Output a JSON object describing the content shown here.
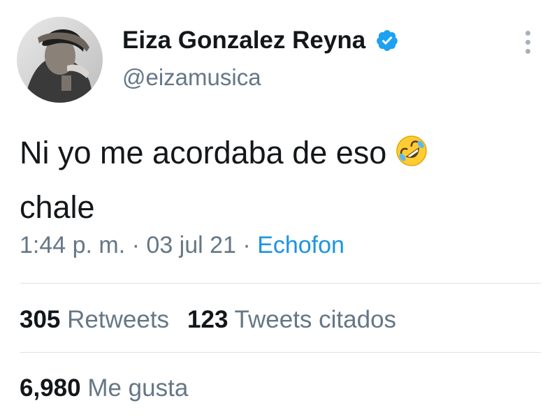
{
  "profile": {
    "display_name": "Eiza Gonzalez Reyna",
    "handle": "@eizamusica",
    "verified": true,
    "avatar_icon": "profile-photo-avatar",
    "verified_icon": "verified-badge-icon",
    "verified_color": "#1da1f2"
  },
  "menu": {
    "icon": "more-vertical-icon"
  },
  "tweet": {
    "text_line1": "Ni yo me acordaba de eso",
    "text_line2": "chale",
    "emoji_icon": "rolling-on-floor-laughing-emoji"
  },
  "meta": {
    "time": "1:44 p. m.",
    "separator": " · ",
    "date": "03 jul 21",
    "source": "Echofon"
  },
  "stats": {
    "retweets_count": "305",
    "retweets_label": "Retweets",
    "quotes_count": "123",
    "quotes_label": "Tweets citados",
    "likes_count": "6,980",
    "likes_label": "Me gusta"
  },
  "colors": {
    "text_primary": "#14171a",
    "text_secondary": "#657786",
    "link": "#1b95e0",
    "divider": "#dde3e8"
  }
}
